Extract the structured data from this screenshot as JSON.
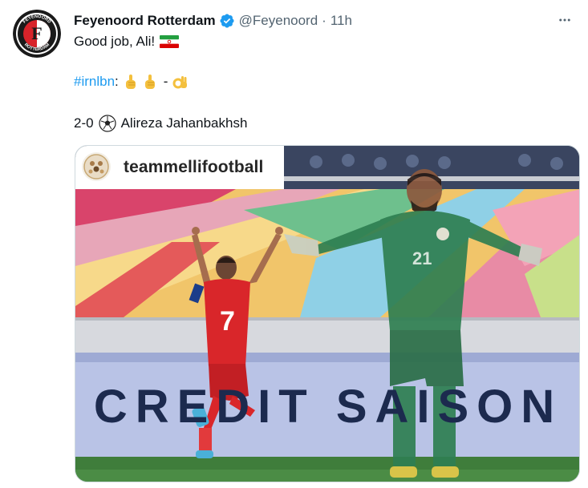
{
  "tweet": {
    "display_name": "Feyenoord Rotterdam",
    "handle": "@Feyenoord",
    "separator": "·",
    "time": "11h",
    "verified_icon": "verified-badge-icon",
    "more_icon": "more-options-icon",
    "line1_text": "Good job, Ali!",
    "line1_emoji": "flag-iran-icon",
    "line2_hashtag": "#irnlbn",
    "line2_colon": ":",
    "line2_dash": "-",
    "line2_emojis": [
      "index-up-icon",
      "index-up-icon",
      "ok-hand-icon"
    ],
    "line3_score": "2-0",
    "line3_emoji": "soccer-ball-icon",
    "line3_player": "Alireza Jahanbakhsh"
  },
  "avatar": {
    "logo_text_top": "FEYENOORD",
    "logo_text_bottom": "ROTTERDAM",
    "logo_letter": "F"
  },
  "media": {
    "account_name": "teammellifootball",
    "banner_text": "CREDIT SAISON",
    "player_number": "7",
    "keeper_number": "21"
  },
  "colors": {
    "link": "#1d9bf0",
    "secondary_text": "#536471",
    "verified": "#1d9bf0",
    "iran_red": "#d42b2b",
    "lebanon_green": "#2e7d4f"
  }
}
